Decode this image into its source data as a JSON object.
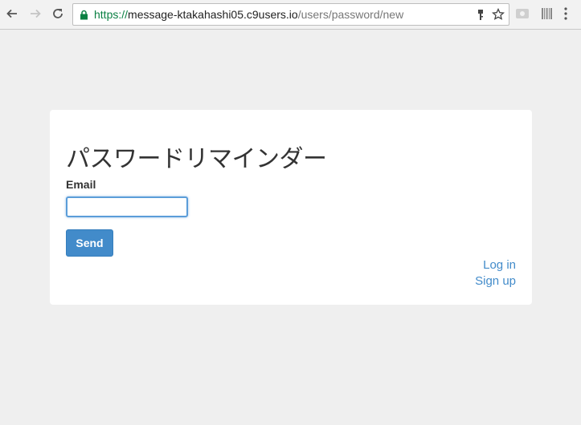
{
  "browser": {
    "url_scheme": "https://",
    "url_host": "message-ktakahashi05.c9users.io",
    "url_path": "/users/password/new"
  },
  "form": {
    "title": "パスワードリマインダー",
    "email_label": "Email",
    "email_value": "",
    "send_label": "Send"
  },
  "links": {
    "login": "Log in",
    "signup": "Sign up"
  },
  "colors": {
    "accent": "#428bca",
    "secure": "#0b8043"
  }
}
